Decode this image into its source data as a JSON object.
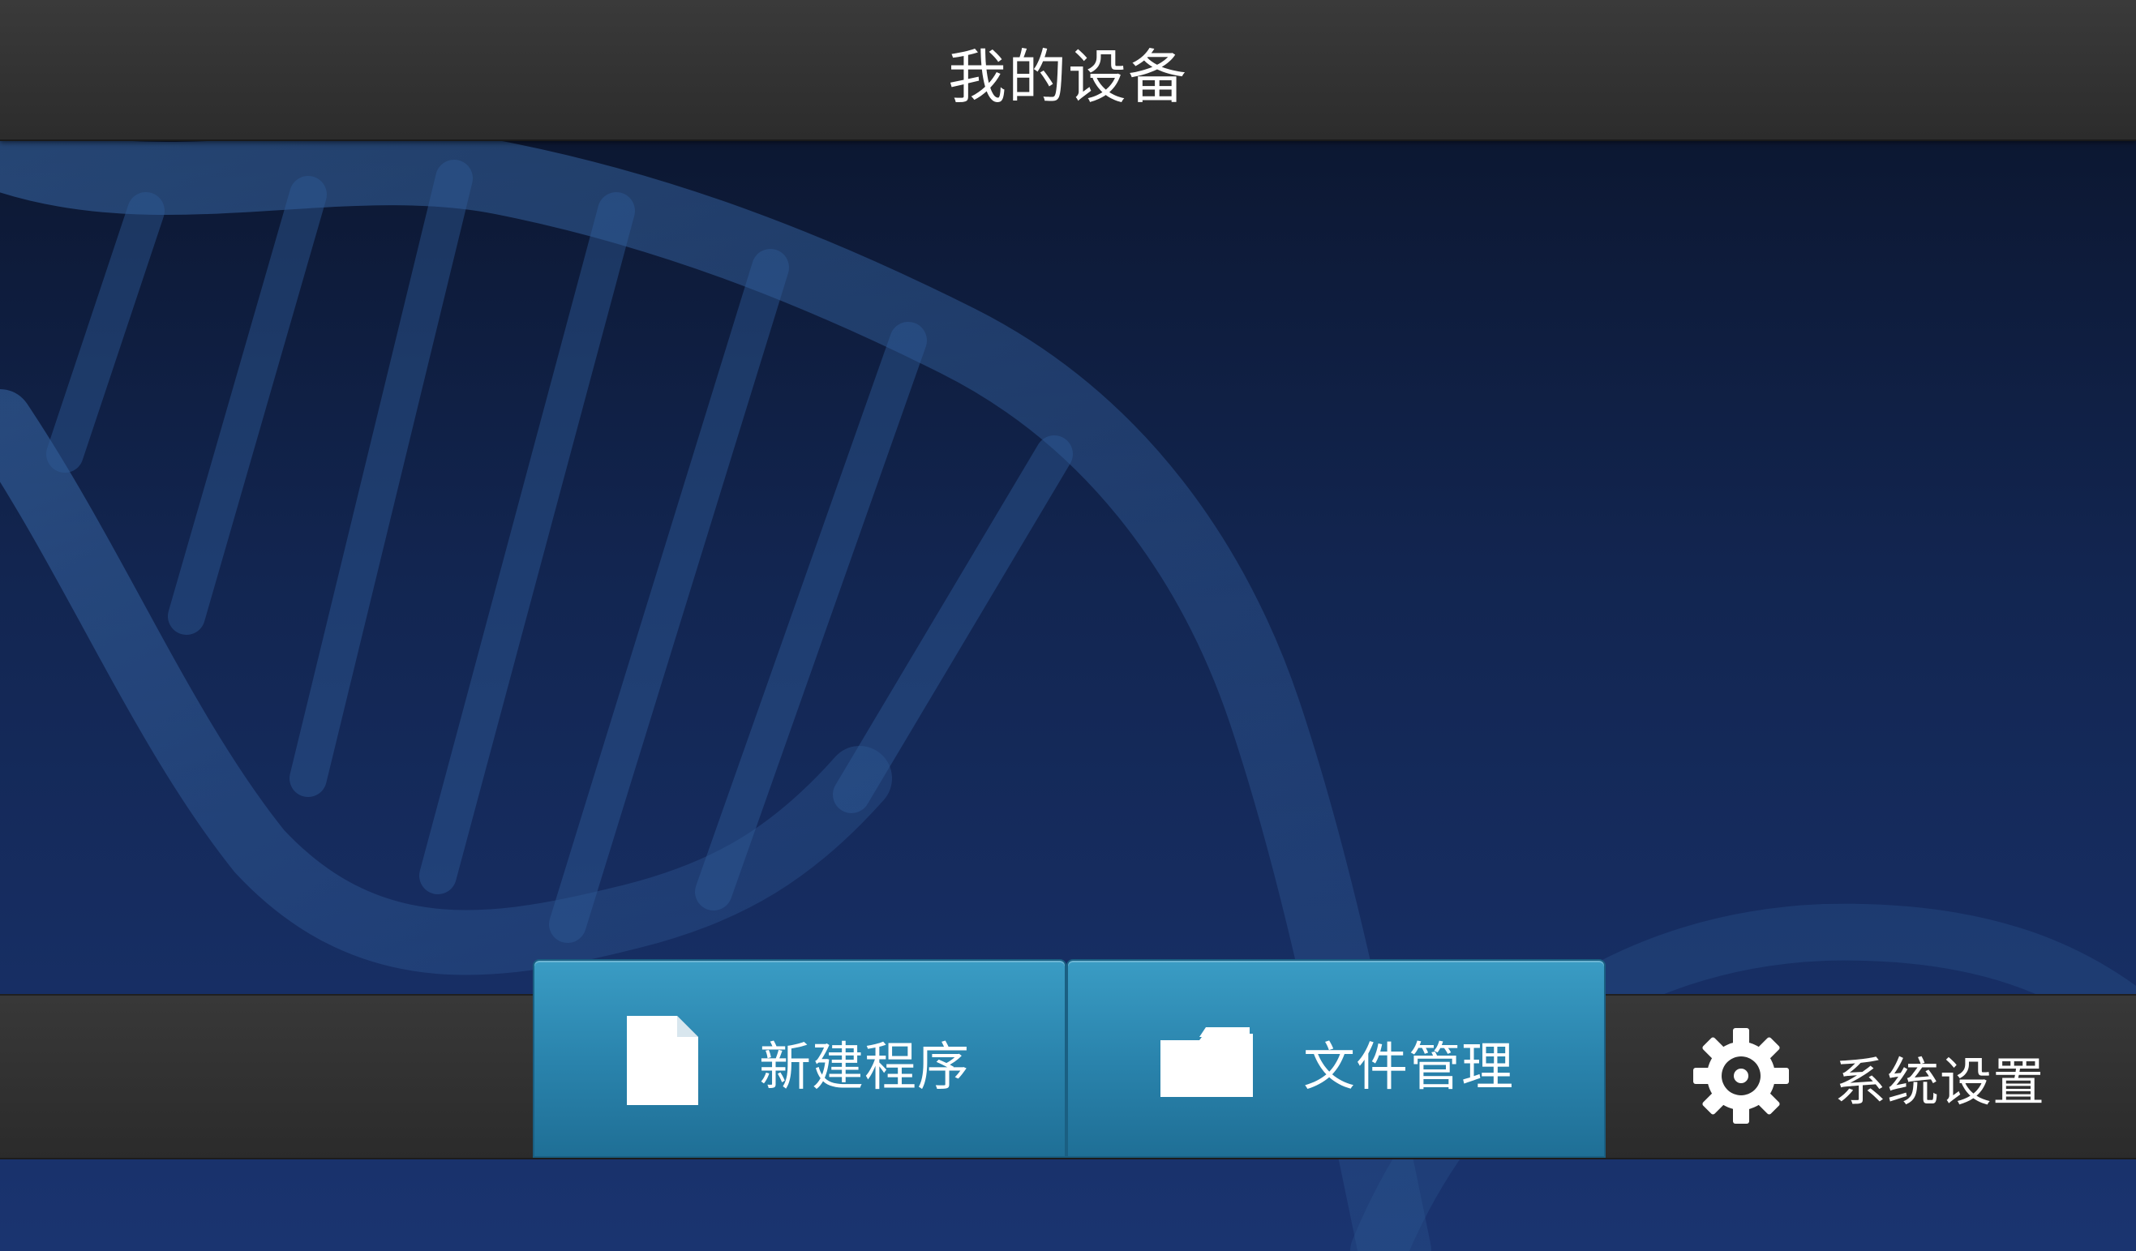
{
  "header": {
    "title": "我的设备"
  },
  "nav": {
    "new_program": {
      "label": "新建程序",
      "icon": "document-icon"
    },
    "file_manager": {
      "label": "文件管理",
      "icon": "folder-icon"
    },
    "system_settings": {
      "label": "系统设置",
      "icon": "gear-icon"
    }
  },
  "theme": {
    "bar_color": "#323232",
    "active_tab_color": "#2a84ad",
    "background_top": "#0a1328",
    "background_bottom": "#1a3470",
    "text_color": "#ffffff"
  }
}
